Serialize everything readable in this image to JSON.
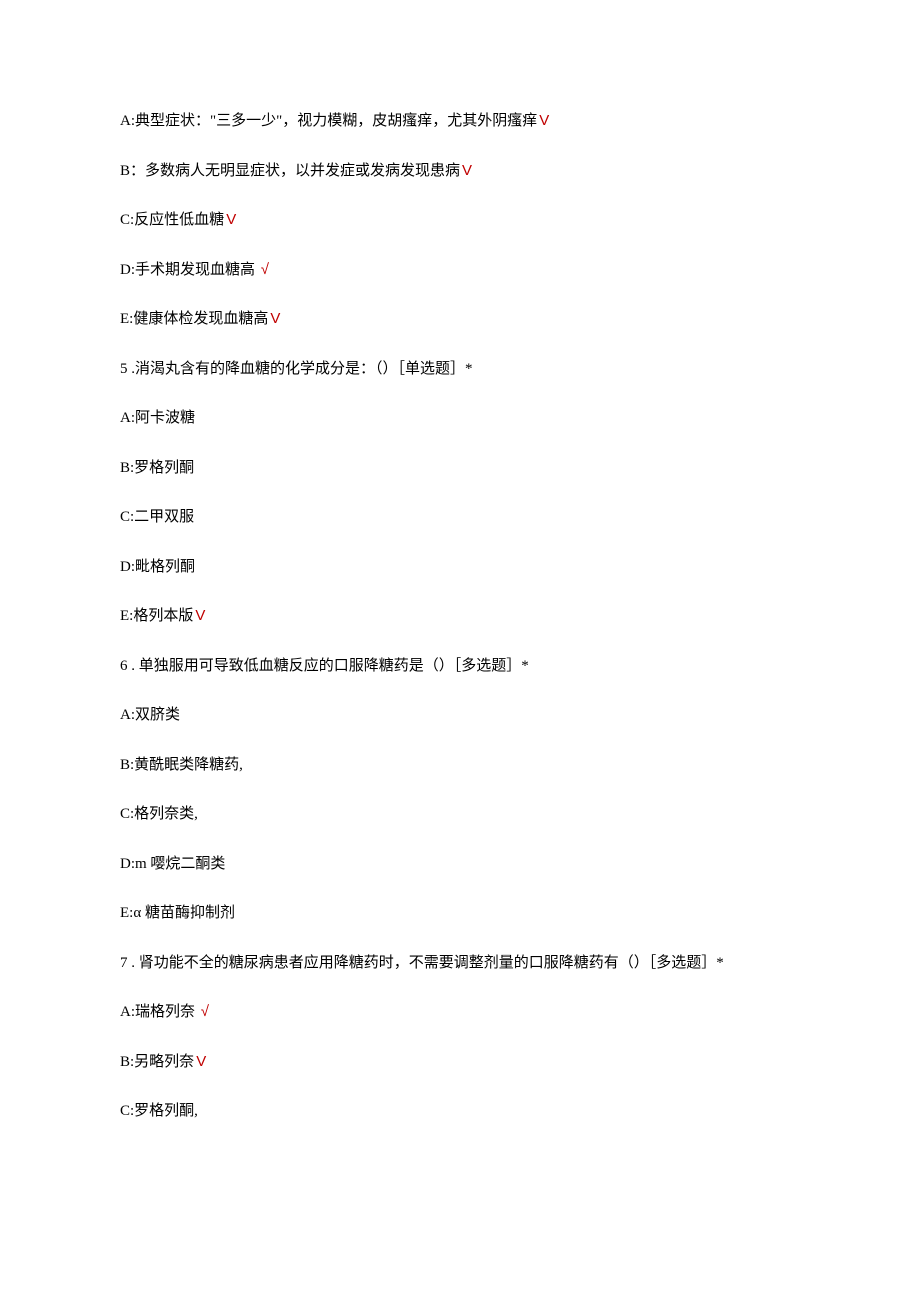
{
  "lines": {
    "l1": {
      "text": "A:典型症状：\"三多一少\"，视力模糊，皮胡瘙痒，尤其外阴瘙痒",
      "mark": "V"
    },
    "l2": {
      "text": "B：多数病人无明显症状，以并发症或发病发现患病",
      "mark": "V"
    },
    "l3": {
      "text": "C:反应性低血糖",
      "mark": "V"
    },
    "l4": {
      "text": "D:手术期发现血糖高 ",
      "mark": "√"
    },
    "l5": {
      "text": "E:健康体检发现血糖高",
      "mark": "V"
    },
    "l6": {
      "text": "5  .消渴丸含有的降血糖的化学成分是：（）［单选题］*",
      "mark": ""
    },
    "l7": {
      "text": "A:阿卡波糖",
      "mark": ""
    },
    "l8": {
      "text": "B:罗格列酮",
      "mark": ""
    },
    "l9": {
      "text": "C:二甲双服",
      "mark": ""
    },
    "l10": {
      "text": "D:毗格列酮",
      "mark": ""
    },
    "l11": {
      "text": "E:格列本版",
      "mark": "V"
    },
    "l12": {
      "text": "6  . 单独服用可导致低血糖反应的口服降糖药是（）［多选题］*",
      "mark": ""
    },
    "l13": {
      "text": "A:双脐类",
      "mark": ""
    },
    "l14": {
      "text": "B:黄酰眠类降糖药,",
      "mark": ""
    },
    "l15": {
      "text": "C:格列奈类,",
      "mark": ""
    },
    "l16": {
      "text": "D:m 嘤烷二酮类",
      "mark": ""
    },
    "l17": {
      "text": "E:α 糖苗酶抑制剂",
      "mark": ""
    },
    "l18": {
      "text": "7  . 肾功能不全的糖尿病患者应用降糖药时，不需要调整剂量的口服降糖药有（）［多选题］*",
      "mark": ""
    },
    "l19": {
      "text": "A:瑞格列奈 ",
      "mark": "√"
    },
    "l20": {
      "text": "B:另略列奈",
      "mark": "V"
    },
    "l21": {
      "text": "C:罗格列酮,",
      "mark": ""
    }
  }
}
